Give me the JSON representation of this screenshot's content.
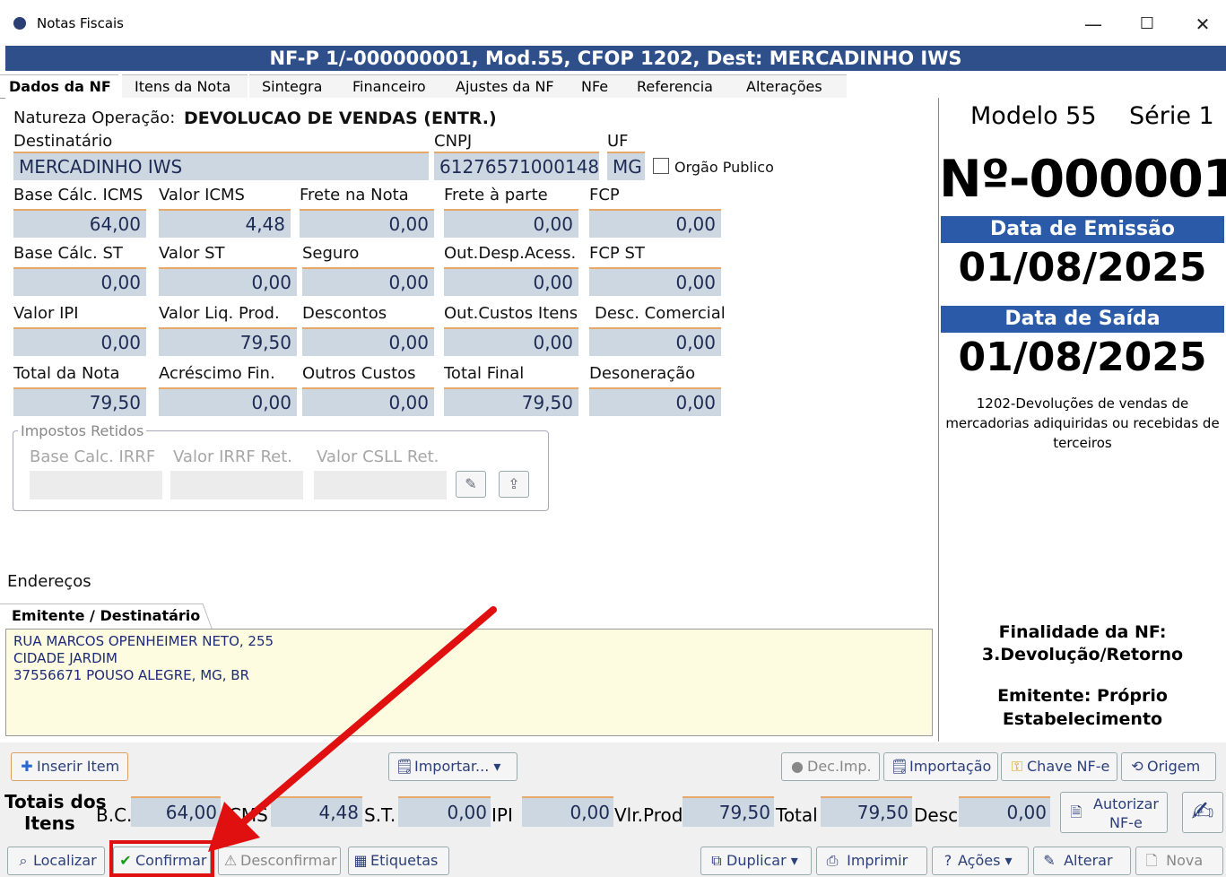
{
  "window": {
    "title": "Notas Fiscais",
    "minimize": "—",
    "maximize": "☐",
    "close": "✕"
  },
  "banner": "NF-P 1/-000000001, Mod.55, CFOP 1202, Dest: MERCADINHO IWS",
  "tabs": [
    "Dados da NF",
    "Itens da Nota",
    "Sintegra",
    "Financeiro",
    "Ajustes da NF",
    "NFe",
    "Referencia",
    "Alterações"
  ],
  "form": {
    "natureza_label": "Natureza Operação:",
    "natureza_value": "DEVOLUCAO DE VENDAS (ENTR.)",
    "destinatario_label": "Destinatário",
    "destinatario_value": "MERCADINHO IWS",
    "cnpj_label": "CNPJ",
    "cnpj_value": "61276571000148",
    "uf_label": "UF",
    "uf_value": "MG",
    "orgao_publico_label": "Orgão Publico",
    "rows": [
      [
        {
          "label": "Base Cálc. ICMS",
          "value": "64,00"
        },
        {
          "label": "Valor ICMS",
          "value": "4,48"
        },
        {
          "label": "Frete na Nota",
          "value": "0,00"
        },
        {
          "label": "Frete à parte",
          "value": "0,00"
        },
        {
          "label": "FCP",
          "value": "0,00"
        }
      ],
      [
        {
          "label": "Base Cálc. ST",
          "value": "0,00"
        },
        {
          "label": "Valor ST",
          "value": "0,00"
        },
        {
          "label": "Seguro",
          "value": "0,00"
        },
        {
          "label": "Out.Desp.Acess.",
          "value": "0,00"
        },
        {
          "label": "FCP ST",
          "value": "0,00"
        }
      ],
      [
        {
          "label": "Valor IPI",
          "value": "0,00"
        },
        {
          "label": "Valor Liq. Prod.",
          "value": "79,50"
        },
        {
          "label": "Descontos",
          "value": "0,00"
        },
        {
          "label": "Out.Custos Itens",
          "value": "0,00"
        },
        {
          "label": "Desc. Comercial",
          "value": "0,00"
        }
      ],
      [
        {
          "label": "Total da Nota",
          "value": "79,50"
        },
        {
          "label": "Acréscimo Fin.",
          "value": "0,00"
        },
        {
          "label": "Outros Custos",
          "value": "0,00"
        },
        {
          "label": "Total Final",
          "value": "79,50"
        },
        {
          "label": "Desoneração",
          "value": "0,00"
        }
      ]
    ],
    "impostos_retidos": {
      "title": "Impostos Retidos",
      "labels": [
        "Base Calc. IRRF",
        "Valor IRRF Ret.",
        "Valor CSLL Ret."
      ]
    }
  },
  "enderecos": {
    "label": "Endereços",
    "tab": "Emitente / Destinatário",
    "lines": [
      "RUA MARCOS OPENHEIMER NETO, 255",
      "CIDADE JARDIM",
      "37556671 POUSO ALEGRE, MG, BR"
    ]
  },
  "right_panel": {
    "modelo": "Modelo 55",
    "serie": "Série 1",
    "numero": "Nº-000001",
    "data_emissao_label": "Data de Emissão",
    "data_emissao": "01/08/2025",
    "data_saida_label": "Data de Saída",
    "data_saida": "01/08/2025",
    "cfop_desc_1": "1202-Devoluções de vendas de",
    "cfop_desc_2": "mercadorias adiquiridas ou recebidas de",
    "cfop_desc_3": "terceiros",
    "finalidade_label": "Finalidade da NF:",
    "finalidade_value": "3.Devolução/Retorno",
    "emitente_line1": "Emitente: Próprio",
    "emitente_line2": "Estabelecimento"
  },
  "toolbar": {
    "inserir_item": "Inserir Item",
    "importar": "Importar...",
    "dec_imp": "Dec.Imp.",
    "importacao": "Importação",
    "chave_nfe": "Chave NF-e",
    "origem": "Origem",
    "totais_line1": "Totais dos",
    "totais_line2": "Itens",
    "bc_label": "B.C.",
    "bc_value": "64,00",
    "icms_label": "ICMS",
    "icms_value": "4,48",
    "st_label": "S.T.",
    "st_value": "0,00",
    "ipi_label": "IPI",
    "ipi_value": "0,00",
    "vlprod_label": "Vlr.Prod.",
    "vlprod_value": "79,50",
    "total_label": "Total",
    "total_value": "79,50",
    "desc_label": "Desc.",
    "desc_value": "0,00",
    "autorizar_1": "Autorizar",
    "autorizar_2": "NF-e",
    "localizar": "Localizar",
    "confirmar": "Confirmar",
    "desconfirmar": "Desconfirmar",
    "etiquetas": "Etiquetas",
    "duplicar": "Duplicar",
    "imprimir": "Imprimir",
    "acoes": "Ações",
    "alterar": "Alterar",
    "nova": "Nova"
  },
  "colors": {
    "banner": "#2f4f8a",
    "field_bg": "#cdd7e1",
    "field_border": "#e8a86a",
    "highlight": "#e01010",
    "date_bar": "#2a5aa8"
  }
}
